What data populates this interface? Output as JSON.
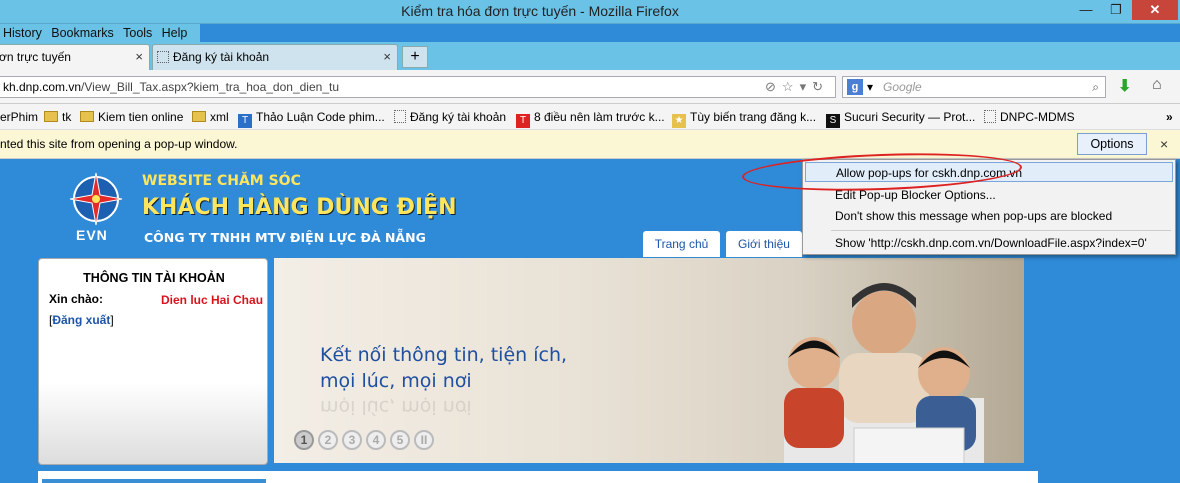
{
  "window": {
    "title": "Kiểm tra hóa đơn trực tuyến - Mozilla Firefox",
    "minimize": "—",
    "restore": "❐",
    "close": "✕"
  },
  "menu": {
    "history": "History",
    "bookmarks": "Bookmarks",
    "tools": "Tools",
    "help": "Help"
  },
  "tabs": [
    {
      "label": "ơn trực tuyến",
      "close": "×"
    },
    {
      "label": "Đăng ký tài khoản",
      "close": "×"
    }
  ],
  "newtab": "+",
  "nav": {
    "url_host": "kh.dnp.com.vn",
    "url_path": "/View_Bill_Tax.aspx?kiem_tra_hoa_don_dien_tu",
    "search_engine": "g",
    "search_placeholder": "Google"
  },
  "bookmarks": [
    "erPhim",
    "tk",
    "Kiem tien online",
    "xml",
    "Thảo Luận Code phim...",
    "Đăng ký tài khoản",
    "8 điều nên làm trước k...",
    "Tùy biến trang đăng k...",
    "Sucuri Security — Prot...",
    "DNPC-MDMS"
  ],
  "bookmarks_more": "»",
  "popup_bar": {
    "message": "nted this site from opening a pop-up window.",
    "options_label": "Options",
    "close": "×"
  },
  "popup_menu": {
    "allow": "Allow pop-ups for cskh.dnp.com.vn",
    "edit": "Edit Pop-up Blocker Options...",
    "dont_show": "Don't show this message when pop-ups are blocked",
    "show": "Show 'http://cskh.dnp.com.vn/DownloadFile.aspx?index=0'"
  },
  "site": {
    "logo_text": "EVN",
    "line1": "WEBSITE CHĂM SÓC",
    "line2": "KHÁCH HÀNG DÙNG ĐIỆN",
    "line3": "CÔNG TY TNHH MTV ĐIỆN LỰC ĐÀ NẴNG",
    "nav_home": "Trang chủ",
    "nav_about": "Giới thiệu"
  },
  "account": {
    "title": "THÔNG TIN TÀI KHOẢN",
    "greeting": "Xin chào:",
    "name": "Dien luc Hai Chau",
    "logout_open": "[",
    "logout": "Đăng xuất",
    "logout_close": "]"
  },
  "banner": {
    "line1": "Kết nối thông tin, tiện ích,",
    "line2": "mọi lúc, mọi nơi",
    "slides": [
      "1",
      "2",
      "3",
      "4",
      "5"
    ],
    "pause": "II"
  },
  "colors": {
    "page_bg": "#2f8ad8",
    "brand_yellow": "#ffe55c",
    "name_red": "#d8131b",
    "popup_highlight": "#e2edfa"
  }
}
